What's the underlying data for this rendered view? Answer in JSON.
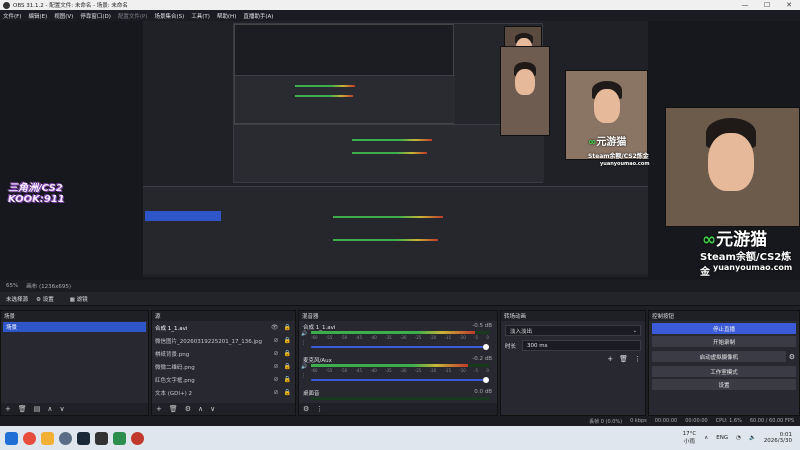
{
  "window": {
    "title": "OBS 31.1.2 - 配置文件: 未命名 - 场景: 未命名",
    "controls": [
      "—",
      "☐",
      "✕"
    ]
  },
  "menu": [
    "文件(F)",
    "编辑(E)",
    "视图(V)",
    "停靠窗口(D)",
    "配置文件(P)",
    "场景集合(S)",
    "工具(T)",
    "帮助(H)",
    "直播助手(A)"
  ],
  "preview": {
    "watermark_line1": "三角洲/CS2",
    "watermark_line2": "KOOK:911",
    "brand_name": "元游猫",
    "brand_sub": "Steam余额/CS2炼金",
    "brand_url": "yuanyoumao.com"
  },
  "status_line": {
    "zoom": "65%",
    "size": "画布 (1236x695)"
  },
  "scene_toolbar": {
    "label": "未选择源",
    "props": "设置",
    "filters": "滤镜"
  },
  "scenes": {
    "title": "场景",
    "items": [
      "场景"
    ]
  },
  "sources": {
    "title": "源",
    "items": [
      "合成 1_1.avi",
      "微信图片_20260319225201_17_136.jpg",
      "棋纸背景.png",
      "微微二维码.png",
      "红色文字框.png",
      "文本 (GDI+) 2"
    ]
  },
  "mixer": {
    "title": "混音器",
    "scale": [
      "-60",
      "-55",
      "-50",
      "-45",
      "-40",
      "-35",
      "-30",
      "-25",
      "-20",
      "-15",
      "-10",
      "-5",
      "0"
    ],
    "channels": [
      {
        "name": "合成 1_1.avi",
        "db": "-0.5 dB",
        "level": 0.92
      },
      {
        "name": "麦克风/Aux",
        "db": "-0.2 dB",
        "level": 0.88
      },
      {
        "name": "桌面音",
        "db": "0.0 dB",
        "level": 0.0
      }
    ]
  },
  "transitions": {
    "title": "转场动画",
    "selected": "淡入淡出",
    "duration_label": "时长",
    "duration_value": "300 ms"
  },
  "controls": {
    "title": "控制按钮",
    "stop_stream": "停止直播",
    "start_record": "开始录制",
    "start_vcam": "启动虚拟摄像机",
    "studio_mode": "工作室模式",
    "settings": "设置"
  },
  "bottom_status": {
    "frames": "丢帧 0 (0.0%)",
    "kbps": "0 kbps",
    "live_time": "00:00:00",
    "rec_time": "00:00:00",
    "cpu": "CPU: 1.6%",
    "fps": "60.00 / 60.00 FPS"
  },
  "taskbar": {
    "weather_temp": "17°C",
    "weather_desc": "小雨",
    "lang": "ENG",
    "time": "0:01",
    "date": "2026/3/30"
  }
}
